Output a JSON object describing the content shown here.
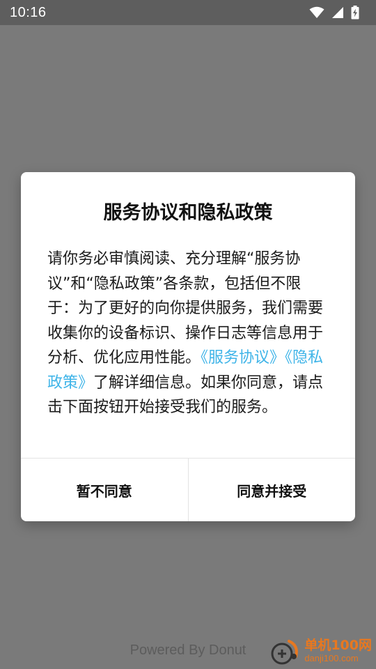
{
  "status_bar": {
    "time": "10:16",
    "icons": [
      "wifi-icon",
      "signal-icon",
      "battery-charging-icon"
    ]
  },
  "dialog": {
    "title": "服务协议和隐私政策",
    "body_prefix": "请你务必审慎阅读、充分理解“服务协议”和“隐私政策”各条款，包括但不限于：为了更好的向你提供服务，我们需要收集你的设备标识、操作日志等信息用于分析、优化应用性能。",
    "link_service": "《服务协议》",
    "link_privacy": "《隐私政策》",
    "body_suffix": "了解详细信息。如果你同意，请点击下面按钮开始接受我们的服务。",
    "decline_label": "暂不同意",
    "accept_label": "同意并接受"
  },
  "footer": {
    "powered_by": "Powered By Donut"
  },
  "watermark": {
    "name": "单机100网",
    "url": "danji100.com"
  },
  "colors": {
    "overlay": "#7a7a7a",
    "status_bar": "#5e5e5e",
    "link": "#3fb4e8",
    "watermark": "#e87820"
  }
}
